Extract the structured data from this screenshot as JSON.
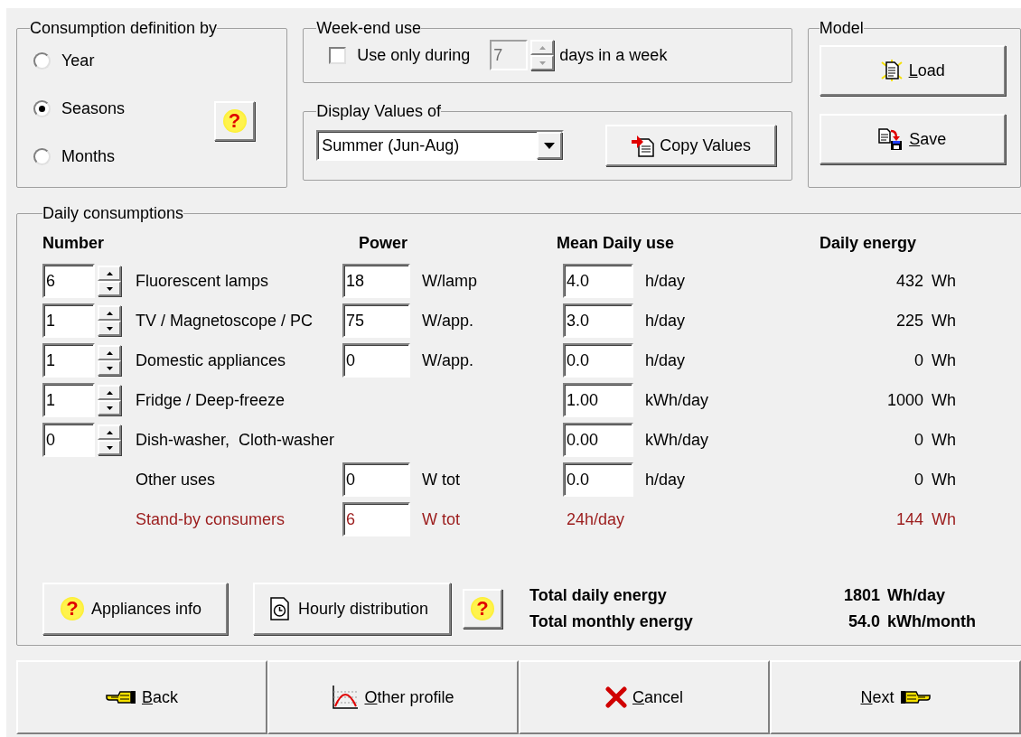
{
  "definition": {
    "title": "Consumption definition by",
    "options": [
      {
        "label": "Year",
        "selected": false
      },
      {
        "label": "Seasons",
        "selected": true
      },
      {
        "label": "Months",
        "selected": false
      }
    ],
    "help_button": "?"
  },
  "weekend": {
    "title": "Week-end use",
    "checkbox": {
      "label": "Use only during",
      "checked": false
    },
    "days": {
      "value": "7",
      "disabled": true
    },
    "suffix": "days in a week"
  },
  "display": {
    "title": "Display Values of",
    "dropdown": {
      "value": "Summer (Jun-Aug)"
    },
    "copy_button": {
      "label": "Copy Values"
    }
  },
  "model": {
    "title": "Model",
    "buttons": [
      {
        "label": "Load"
      },
      {
        "label": "Save"
      }
    ]
  },
  "daily": {
    "title": "Daily consumptions",
    "headers": {
      "number": "Number",
      "power": "Power",
      "use": "Mean Daily use",
      "energy": "Daily energy"
    },
    "rows": [
      {
        "kind": "appliance",
        "number": "6",
        "label": "Fluorescent lamps",
        "power": "18",
        "power_unit": "W/lamp",
        "use": "4.0",
        "use_unit": "h/day",
        "energy": "432",
        "energy_unit": "Wh"
      },
      {
        "kind": "appliance",
        "number": "1",
        "label": "TV / Magnetoscope / PC",
        "power": "75",
        "power_unit": "W/app.",
        "use": "3.0",
        "use_unit": "h/day",
        "energy": "225",
        "energy_unit": "Wh"
      },
      {
        "kind": "appliance",
        "number": "1",
        "label": "Domestic appliances",
        "power": "0",
        "power_unit": "W/app.",
        "use": "0.0",
        "use_unit": "h/day",
        "energy": "0",
        "energy_unit": "Wh"
      },
      {
        "kind": "appliance",
        "number": "1",
        "label": "Fridge / Deep-freeze",
        "use": "1.00",
        "use_unit": "kWh/day",
        "energy": "1000",
        "energy_unit": "Wh"
      },
      {
        "kind": "appliance",
        "number": "0",
        "label": "Dish-washer,  Cloth-washer",
        "use": "0.00",
        "use_unit": "kWh/day",
        "energy": "0",
        "energy_unit": "Wh"
      },
      {
        "kind": "other",
        "label": "Other uses",
        "power": "0",
        "power_unit": "W tot",
        "use": "0.0",
        "use_unit": "h/day",
        "energy": "0",
        "energy_unit": "Wh"
      },
      {
        "kind": "standby",
        "label": "Stand-by consumers",
        "power": "6",
        "power_unit": "W tot",
        "use_text": "24h/day",
        "energy": "144",
        "energy_unit": "Wh"
      }
    ],
    "buttons": [
      {
        "label": "Appliances info",
        "glyph": "?"
      },
      {
        "label": "Hourly distribution"
      }
    ],
    "help_button": "?",
    "totals": [
      {
        "label": "Total daily energy",
        "value": "1801",
        "unit": "Wh/day"
      },
      {
        "label": "Total monthly energy",
        "value": "54.0",
        "unit": "kWh/month"
      }
    ]
  },
  "nav_buttons": [
    {
      "label": "Back"
    },
    {
      "label": "Other profile"
    },
    {
      "label": "Cancel"
    },
    {
      "label": "Next"
    }
  ]
}
